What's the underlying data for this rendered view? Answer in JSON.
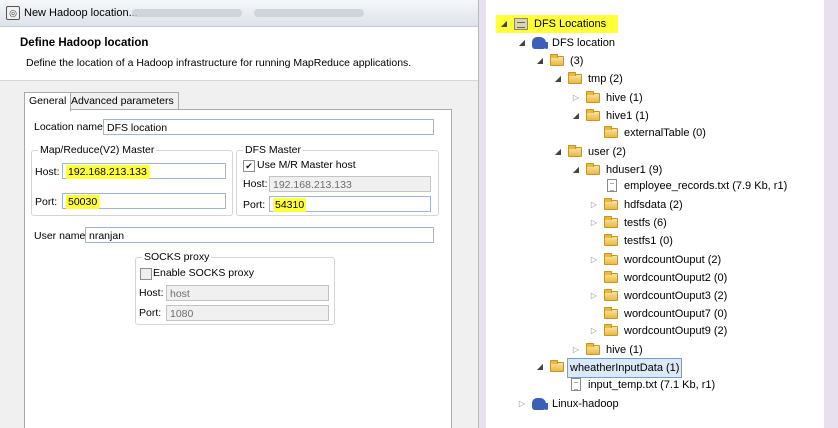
{
  "dialog": {
    "window_title": "New Hadoop location...",
    "header_title": "Define Hadoop location",
    "header_desc": "Define the location of a Hadoop infrastructure for running MapReduce applications.",
    "tabs": [
      {
        "label": "General",
        "active": true
      },
      {
        "label": "Advanced parameters",
        "active": false
      }
    ],
    "location_name": {
      "label": "Location name:",
      "value": "DFS location"
    },
    "mr_master": {
      "title": "Map/Reduce(V2) Master",
      "host_label": "Host:",
      "host_value": "192.168.213.133",
      "port_label": "Port:",
      "port_value": "50030"
    },
    "dfs_master": {
      "title": "DFS Master",
      "use_mr_label": "Use M/R Master host",
      "use_mr_checked": true,
      "host_label": "Host:",
      "host_value": "192.168.213.133",
      "port_label": "Port:",
      "port_value": "54310"
    },
    "user_name": {
      "label": "User name:",
      "value": "nranjan"
    },
    "socks": {
      "title": "SOCKS proxy",
      "enable_label": "Enable SOCKS proxy",
      "enable_checked": false,
      "host_label": "Host:",
      "host_placeholder": "host",
      "port_label": "Port:",
      "port_value": "1080"
    },
    "highlight_color": "#ffff3a"
  },
  "tree": {
    "rows": [
      {
        "id": "dfs-locations",
        "label": "DFS Locations",
        "twisty": "expanded",
        "icon": "dfs-icon",
        "style": "yellow"
      },
      {
        "id": "dfs-location",
        "label": "DFS location",
        "twisty": "expanded",
        "icon": "elephant-icon"
      },
      {
        "id": "root",
        "label": "(3)",
        "twisty": "expanded",
        "icon": "folder-icon"
      },
      {
        "id": "tmp",
        "label": "tmp (2)",
        "twisty": "expanded",
        "icon": "folder-icon"
      },
      {
        "id": "hive",
        "label": "hive (1)",
        "twisty": "collapsed",
        "icon": "folder-icon"
      },
      {
        "id": "hive1",
        "label": "hive1 (1)",
        "twisty": "expanded",
        "icon": "folder-icon"
      },
      {
        "id": "externaltable",
        "label": "externalTable (0)",
        "twisty": "none",
        "icon": "folder-icon"
      },
      {
        "id": "user",
        "label": "user (2)",
        "twisty": "expanded",
        "icon": "folder-icon"
      },
      {
        "id": "hduser1",
        "label": "hduser1 (9)",
        "twisty": "expanded",
        "icon": "folder-icon"
      },
      {
        "id": "employee-records",
        "label": "employee_records.txt (7.9 Kb, r1)",
        "twisty": "none",
        "icon": "file-icon"
      },
      {
        "id": "hdfsdata",
        "label": "hdfsdata (2)",
        "twisty": "collapsed",
        "icon": "folder-icon"
      },
      {
        "id": "testfs",
        "label": "testfs (6)",
        "twisty": "collapsed",
        "icon": "folder-icon"
      },
      {
        "id": "testfs1",
        "label": "testfs1 (0)",
        "twisty": "none",
        "icon": "folder-icon"
      },
      {
        "id": "wordcountouput",
        "label": "wordcountOuput (2)",
        "twisty": "collapsed",
        "icon": "folder-icon"
      },
      {
        "id": "wordcountouput2",
        "label": "wordcountOuput2 (0)",
        "twisty": "none",
        "icon": "folder-icon"
      },
      {
        "id": "wordcountouput3",
        "label": "wordcountOuput3 (2)",
        "twisty": "collapsed",
        "icon": "folder-icon"
      },
      {
        "id": "wordcountouput7",
        "label": "wordcountOuput7 (0)",
        "twisty": "none",
        "icon": "folder-icon"
      },
      {
        "id": "wordcountouput9",
        "label": "wordcountOuput9 (2)",
        "twisty": "collapsed",
        "icon": "folder-icon"
      },
      {
        "id": "hive-user",
        "label": "hive (1)",
        "twisty": "collapsed",
        "icon": "folder-icon"
      },
      {
        "id": "wheatherinputdata",
        "label": "wheatherInputData (1)",
        "twisty": "expanded",
        "icon": "folder-icon",
        "style": "selected"
      },
      {
        "id": "input-temp",
        "label": "input_temp.txt (7.1 Kb, r1)",
        "twisty": "none",
        "icon": "file-icon"
      },
      {
        "id": "linux-hadoop",
        "label": "Linux-hadoop",
        "twisty": "collapsed",
        "icon": "elephant-icon"
      }
    ]
  }
}
